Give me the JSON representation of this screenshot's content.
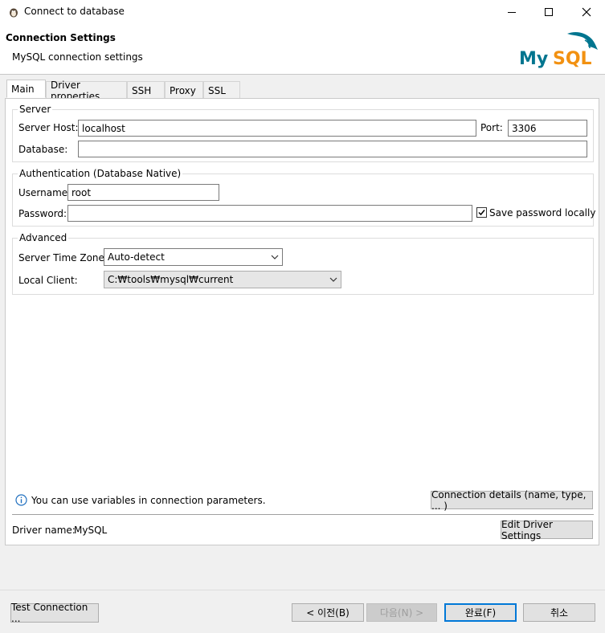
{
  "window": {
    "title": "Connect to database",
    "minimize_icon": "minimize-icon",
    "maximize_icon": "maximize-icon",
    "close_icon": "close-icon"
  },
  "banner": {
    "title": "Connection Settings",
    "subtitle": "MySQL connection settings",
    "logo_text_my": "My",
    "logo_text_sql": "SQL",
    "colors": {
      "logo_blue": "#00758f",
      "logo_orange": "#f29111"
    }
  },
  "tabs": [
    {
      "label": "Main",
      "active": true
    },
    {
      "label": "Driver properties",
      "active": false
    },
    {
      "label": "SSH",
      "active": false
    },
    {
      "label": "Proxy",
      "active": false
    },
    {
      "label": "SSL",
      "active": false
    }
  ],
  "server": {
    "group_label": "Server",
    "host_label": "Server Host:",
    "host_value": "localhost",
    "port_label": "Port:",
    "port_value": "3306",
    "database_label": "Database:",
    "database_value": ""
  },
  "auth": {
    "group_label": "Authentication (Database Native)",
    "username_label": "Username:",
    "username_value": "root",
    "password_label": "Password:",
    "password_value": "",
    "save_password_label": "Save password locally",
    "save_password_checked": true
  },
  "advanced": {
    "group_label": "Advanced",
    "timezone_label": "Server Time Zone:",
    "timezone_value": "Auto-detect",
    "local_client_label": "Local Client:",
    "local_client_value": "C:₩tools₩mysql₩current"
  },
  "info": {
    "text": "You can use variables in connection parameters.",
    "connection_details_button": "Connection details (name, type, ... )"
  },
  "driver": {
    "label": "Driver name:",
    "value": "MySQL",
    "edit_button": "Edit Driver Settings"
  },
  "footer": {
    "test_connection": "Test Connection ...",
    "back": "< 이전(B)",
    "next": "다음(N) >",
    "finish": "완료(F)",
    "cancel": "취소"
  }
}
